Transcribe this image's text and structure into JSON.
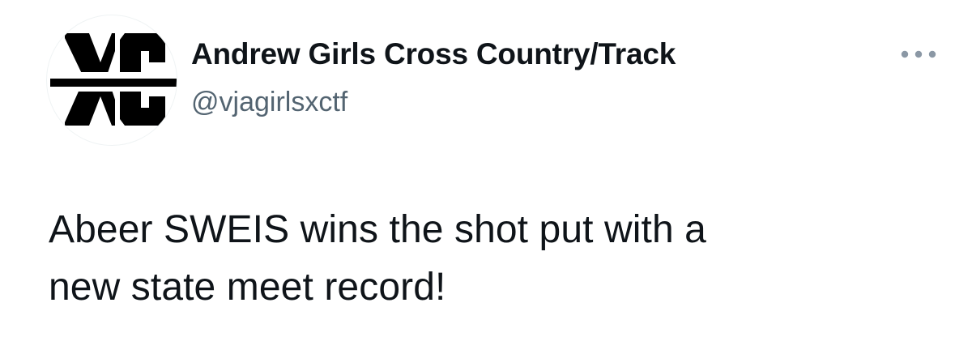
{
  "tweet": {
    "author": {
      "display_name": "Andrew Girls Cross Country/Track",
      "handle": "@vjagirlsxctf",
      "avatar_icon": "xc-logo-avatar",
      "avatar_logo_text": "XC"
    },
    "more_icon": "more-horizontal-icon",
    "text": "Abeer SWEIS wins the shot put with a\nnew state meet record!"
  },
  "colors": {
    "text_primary": "#0f1419",
    "text_secondary": "#536471",
    "background": "#ffffff"
  }
}
